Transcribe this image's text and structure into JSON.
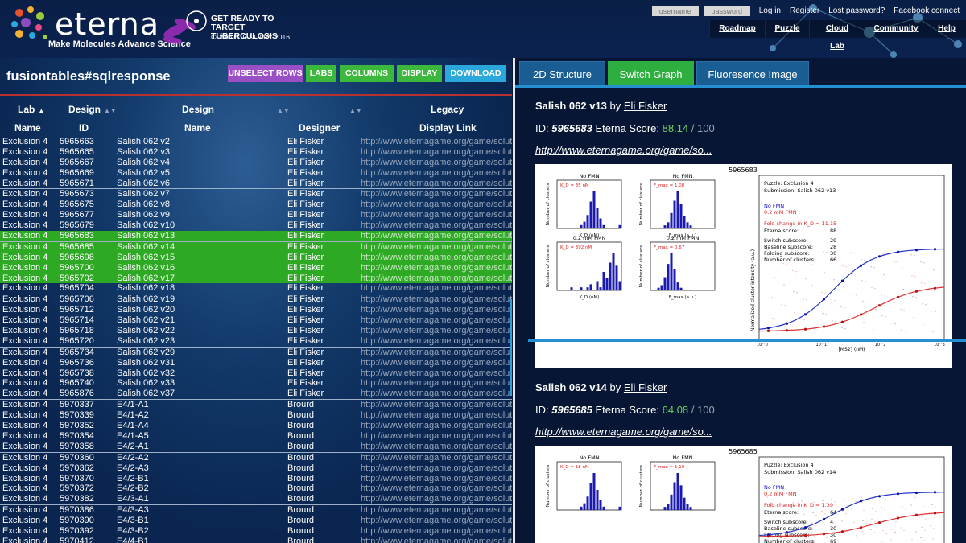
{
  "header": {
    "logo_text": "eterna",
    "tagline": "Make Molecules  Advance Science",
    "promo": {
      "line1": "GET READY TO",
      "line2": "TARGET TUBERCULOSIS",
      "line3": "COMING JANUARY 2016"
    },
    "login": {
      "username_placeholder": "username",
      "password_placeholder": "password",
      "login_label": "Log in",
      "register_label": "Register",
      "lost_password_label": "Lost password?",
      "facebook_label": "Facebook connect"
    },
    "nav": [
      "Roadmap",
      "Puzzle",
      "Cloud Lab",
      "Community",
      "Help"
    ]
  },
  "left": {
    "title": "fusiontables#sqlresponse",
    "buttons": {
      "unselect": "UNSELECT ROWS",
      "labs": "LABS",
      "columns": "COLUMNS",
      "display": "DISPLAY",
      "download": "DOWNLOAD"
    },
    "headers": {
      "lab_top": "Lab",
      "lab_bottom": "Name",
      "design_id_top": "Design",
      "design_id_bottom": "ID",
      "design_name_top": "Design",
      "design_name_bottom": "Name",
      "designer_bottom": "Designer",
      "legacy_top": "Legacy",
      "legacy_bottom": "Display Link"
    },
    "rows": [
      [
        "Exclusion 4",
        "5965663",
        "Salish 062 v2",
        "Eli Fisker",
        "http://www.eternagame.org/game/solution"
      ],
      [
        "Exclusion 4",
        "5965665",
        "Salish 062 v3",
        "Eli Fisker",
        "http://www.eternagame.org/game/solution"
      ],
      [
        "Exclusion 4",
        "5965667",
        "Salish 062 v4",
        "Eli Fisker",
        "http://www.eternagame.org/game/solution"
      ],
      [
        "Exclusion 4",
        "5965669",
        "Salish 062 v5",
        "Eli Fisker",
        "http://www.eternagame.org/game/solution"
      ],
      [
        "Exclusion 4",
        "5965671",
        "Salish 062 v6",
        "Eli Fisker",
        "http://www.eternagame.org/game/solution"
      ],
      [
        "Exclusion 4",
        "5965673",
        "Salish 062 v7",
        "Eli Fisker",
        "http://www.eternagame.org/game/solution"
      ],
      [
        "Exclusion 4",
        "5965675",
        "Salish 062 v8",
        "Eli Fisker",
        "http://www.eternagame.org/game/solution"
      ],
      [
        "Exclusion 4",
        "5965677",
        "Salish 062 v9",
        "Eli Fisker",
        "http://www.eternagame.org/game/solution"
      ],
      [
        "Exclusion 4",
        "5965679",
        "Salish 062 v10",
        "Eli Fisker",
        "http://www.eternagame.org/game/solution"
      ],
      [
        "Exclusion 4",
        "5965683",
        "Salish 062 v13",
        "Eli Fisker",
        "http://www.eternagame.org/game/solution"
      ],
      [
        "Exclusion 4",
        "5965685",
        "Salish 062 v14",
        "Eli Fisker",
        "http://www.eternagame.org/game/solution"
      ],
      [
        "Exclusion 4",
        "5965698",
        "Salish 062 v15",
        "Eli Fisker",
        "http://www.eternagame.org/game/solution"
      ],
      [
        "Exclusion 4",
        "5965700",
        "Salish 062 v16",
        "Eli Fisker",
        "http://www.eternagame.org/game/solution"
      ],
      [
        "Exclusion 4",
        "5965702",
        "Salish 062 v17",
        "Eli Fisker",
        "http://www.eternagame.org/game/solution"
      ],
      [
        "Exclusion 4",
        "5965704",
        "Salish 062 v18",
        "Eli Fisker",
        "http://www.eternagame.org/game/solution"
      ],
      [
        "Exclusion 4",
        "5965706",
        "Salish 062 v19",
        "Eli Fisker",
        "http://www.eternagame.org/game/solution"
      ],
      [
        "Exclusion 4",
        "5965712",
        "Salish 062 v20",
        "Eli Fisker",
        "http://www.eternagame.org/game/solution"
      ],
      [
        "Exclusion 4",
        "5965714",
        "Salish 062 v21",
        "Eli Fisker",
        "http://www.eternagame.org/game/solution"
      ],
      [
        "Exclusion 4",
        "5965718",
        "Salish 062 v22",
        "Eli Fisker",
        "http://www.eternagame.org/game/solution"
      ],
      [
        "Exclusion 4",
        "5965720",
        "Salish 062 v23",
        "Eli Fisker",
        "http://www.eternagame.org/game/solution"
      ],
      [
        "Exclusion 4",
        "5965734",
        "Salish 062 v29",
        "Eli Fisker",
        "http://www.eternagame.org/game/solution"
      ],
      [
        "Exclusion 4",
        "5965736",
        "Salish 062 v31",
        "Eli Fisker",
        "http://www.eternagame.org/game/solution"
      ],
      [
        "Exclusion 4",
        "5965738",
        "Salish 062 v32",
        "Eli Fisker",
        "http://www.eternagame.org/game/solution"
      ],
      [
        "Exclusion 4",
        "5965740",
        "Salish 062 v33",
        "Eli Fisker",
        "http://www.eternagame.org/game/solution"
      ],
      [
        "Exclusion 4",
        "5965876",
        "Salish 062 v37",
        "Eli Fisker",
        "http://www.eternagame.org/game/solution"
      ],
      [
        "Exclusion 4",
        "5970337",
        "E4/1-A1",
        "Brourd",
        "http://www.eternagame.org/game/solution"
      ],
      [
        "Exclusion 4",
        "5970339",
        "E4/1-A2",
        "Brourd",
        "http://www.eternagame.org/game/solution"
      ],
      [
        "Exclusion 4",
        "5970352",
        "E4/1-A4",
        "Brourd",
        "http://www.eternagame.org/game/solution"
      ],
      [
        "Exclusion 4",
        "5970354",
        "E4/1-A5",
        "Brourd",
        "http://www.eternagame.org/game/solution"
      ],
      [
        "Exclusion 4",
        "5970358",
        "E4/2-A1",
        "Brourd",
        "http://www.eternagame.org/game/solution"
      ],
      [
        "Exclusion 4",
        "5970360",
        "E4/2-A2",
        "Brourd",
        "http://www.eternagame.org/game/solution"
      ],
      [
        "Exclusion 4",
        "5970362",
        "E4/2-A3",
        "Brourd",
        "http://www.eternagame.org/game/solution"
      ],
      [
        "Exclusion 4",
        "5970370",
        "E4/2-B1",
        "Brourd",
        "http://www.eternagame.org/game/solution"
      ],
      [
        "Exclusion 4",
        "5970372",
        "E4/2-B2",
        "Brourd",
        "http://www.eternagame.org/game/solution"
      ],
      [
        "Exclusion 4",
        "5970382",
        "E4/3-A1",
        "Brourd",
        "http://www.eternagame.org/game/solution"
      ],
      [
        "Exclusion 4",
        "5970386",
        "E4/3-A3",
        "Brourd",
        "http://www.eternagame.org/game/solution"
      ],
      [
        "Exclusion 4",
        "5970390",
        "E4/3-B1",
        "Brourd",
        "http://www.eternagame.org/game/solution"
      ],
      [
        "Exclusion 4",
        "5970392",
        "E4/3-B2",
        "Brourd",
        "http://www.eternagame.org/game/solution"
      ],
      [
        "Exclusion 4",
        "5970412",
        "E4/4-B1",
        "Brourd",
        "http://www.eternagame.org/game/solution"
      ]
    ],
    "selected_rows": [
      9,
      10,
      11,
      12,
      13
    ],
    "group_starts": [
      5,
      10,
      15,
      20,
      25,
      30,
      35
    ]
  },
  "right": {
    "tabs": [
      "2D Structure",
      "Switch Graph",
      "Fluoresence Image"
    ],
    "active_tab": 1,
    "results": [
      {
        "design_name": "Salish 062 v13",
        "by": "by",
        "designer": "Eli Fisker",
        "id_label": "ID:",
        "id": "5965683",
        "score_label": "Eterna Score:",
        "score": "88.14",
        "score_max": "/ 100",
        "url": "http://www.eternagame.org/game/so...",
        "graph": {
          "header_id": "5965683",
          "panel_titles": [
            "No FMN",
            "No FMN",
            "0.2 mM FMN",
            "0.2 mM FMN"
          ],
          "kd_labels": [
            "K_D = 35 nM",
            "F_max = 1.08",
            "K_D = 392 nM",
            "F_max = 0.67"
          ],
          "y_label": "Number of clusters",
          "x_labels": [
            "K_D (nM)",
            "F_max (a.u.)",
            "K_D (nM)",
            "F_max (a.u.)"
          ],
          "info_lines": [
            "Puzzle: Exclusion 4",
            "Submission: Salish 062 v13"
          ],
          "legend_blue": "No FMN",
          "legend_red": "0.2 mM FMN",
          "fold_change": "Fold change in K_D = 11.15",
          "stats": [
            [
              "Eterna score:",
              "88"
            ],
            [
              "Switch subscore:",
              "29"
            ],
            [
              "Baseline subscore:",
              "28"
            ],
            [
              "Folding subscore:",
              "30"
            ],
            [
              "Number of clusters:",
              "66"
            ]
          ],
          "main_ylabel": "Normalized cluster intensity (a.u.)",
          "main_xlabel": "[MS2] (nM)",
          "x_ticks": [
            "10^0",
            "10^1",
            "10^2",
            "10^3"
          ]
        }
      },
      {
        "design_name": "Salish 062 v14",
        "by": "by",
        "designer": "Eli Fisker",
        "id_label": "ID:",
        "id": "5965685",
        "score_label": "Eterna Score:",
        "score": "64.08",
        "score_max": "/ 100",
        "url": "http://www.eternagame.org/game/so...",
        "graph": {
          "header_id": "5965685",
          "panel_titles": [
            "No FMN",
            "No FMN",
            "0.2 mM FMN",
            "0.2 mM FMN"
          ],
          "kd_labels": [
            "K_D = 18 nM",
            "F_max = 1.19",
            "K_D = 26 nM",
            "F_max = 1.23"
          ],
          "y_label": "Number of clusters",
          "x_labels": [
            "",
            "",
            "",
            ""
          ],
          "info_lines": [
            "Puzzle: Exclusion 4",
            "Submission: Salish 062 v14"
          ],
          "legend_blue": "No FMN",
          "legend_red": "0.2 mM FMN",
          "fold_change": "Fold change in K_D = 1.39",
          "stats": [
            [
              "Eterna score:",
              "64"
            ],
            [
              "Switch subscore:",
              "4"
            ],
            [
              "Baseline subscore:",
              "30"
            ],
            [
              "Folding subscore:",
              "30"
            ],
            [
              "Number of clusters:",
              "69"
            ]
          ],
          "main_ylabel": "",
          "main_xlabel": "",
          "x_ticks": []
        }
      }
    ]
  }
}
